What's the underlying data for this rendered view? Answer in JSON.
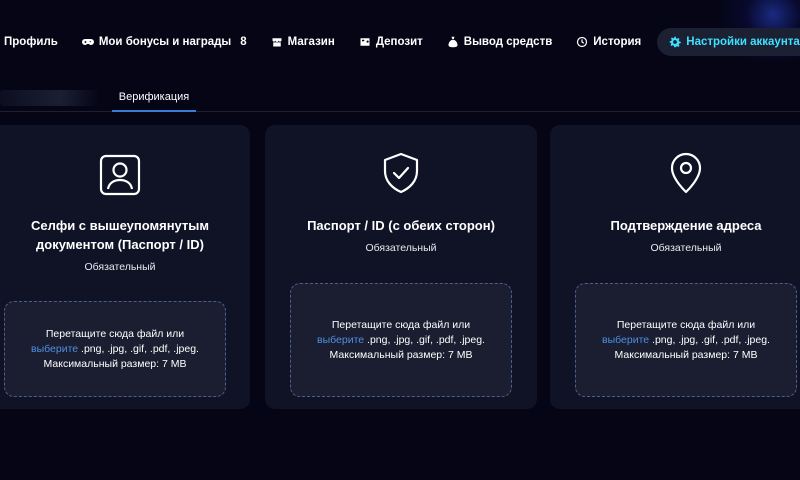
{
  "nav": {
    "items": [
      {
        "label": "Профиль",
        "icon": "profile-icon"
      },
      {
        "label": "Мои бонусы и награды",
        "count": "8",
        "icon": "gamepad-icon"
      },
      {
        "label": "Магазин",
        "icon": "shop-icon"
      },
      {
        "label": "Депозит",
        "icon": "deposit-icon"
      },
      {
        "label": "Вывод средств",
        "icon": "money-bag-icon"
      },
      {
        "label": "История",
        "icon": "history-icon"
      },
      {
        "label": "Настройки аккаунта",
        "icon": "gear-icon",
        "active": true
      }
    ],
    "active_color": "#3fe0ff"
  },
  "subtabs": {
    "verification": "Верификация",
    "underline_color": "#3a7bd5"
  },
  "cards": [
    {
      "icon": "id-card-icon",
      "title_line1": "Селфи с вышеупомянутым",
      "title_line2": "документом (Паспорт / ID)",
      "required": "Обязательный",
      "drop": {
        "line1": "Перетащите сюда файл или",
        "link": "выберите",
        "formats": ".png, .jpg, .gif, .pdf, .jpeg.",
        "max": "Максимальный размер: 7 MB"
      }
    },
    {
      "icon": "shield-check-icon",
      "title": "Паспорт / ID (с обеих сторон)",
      "required": "Обязательный",
      "drop": {
        "line1": "Перетащите сюда файл или",
        "link": "выберите",
        "formats": ".png, .jpg, .gif, .pdf, .jpeg.",
        "max": "Максимальный размер: 7 MB"
      }
    },
    {
      "icon": "location-pin-icon",
      "title": "Подтверждение адреса",
      "required": "Обязательный",
      "drop": {
        "line1": "Перетащите сюда файл или",
        "link": "выберите",
        "formats": ".png, .jpg, .gif, .pdf, .jpeg.",
        "max": "Максимальный размер: 7 MB"
      }
    }
  ],
  "colors": {
    "background": "#050516",
    "card": "#0f1325",
    "dropzone": "#1a1e30",
    "link": "#4e8fe3"
  }
}
